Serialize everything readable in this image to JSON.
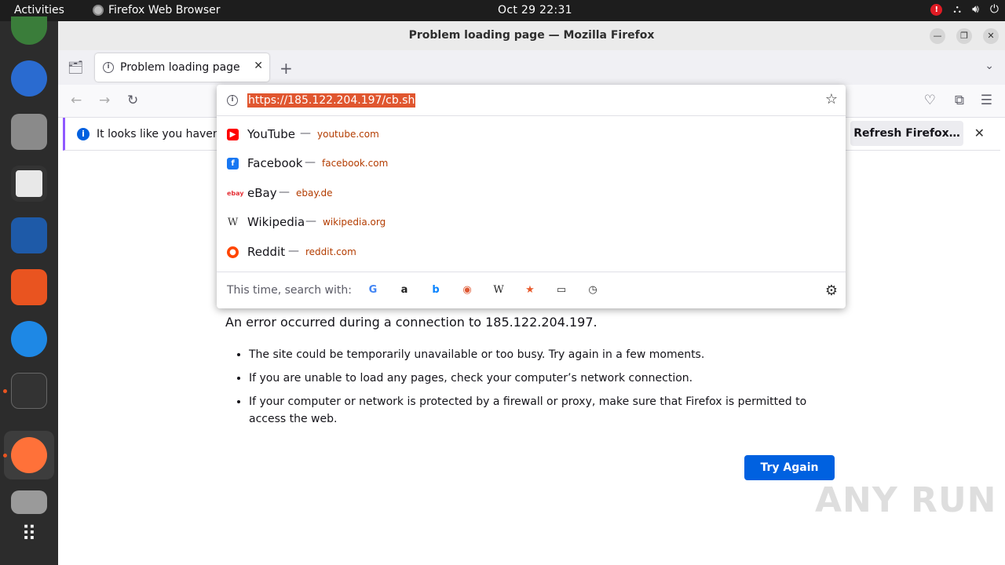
{
  "topbar": {
    "activities": "Activities",
    "app_name": "Firefox Web Browser",
    "clock": "Oct 29  22:31"
  },
  "window": {
    "title": "Problem loading page — Mozilla Firefox"
  },
  "tab": {
    "title": "Problem loading page"
  },
  "notice": {
    "text": "It looks like you haven’t",
    "refresh_label": "Refresh Firefox…"
  },
  "urlbar": {
    "value": "https://185.122.204.197/cb.sh",
    "suggestions": [
      {
        "name": "YouTube",
        "url": "youtube.com",
        "icon": "youtube-icon",
        "color": "#ff0000"
      },
      {
        "name": "Facebook",
        "url": "facebook.com",
        "icon": "facebook-icon",
        "color": "#1877f2"
      },
      {
        "name": "eBay",
        "url": "ebay.de",
        "icon": "ebay-icon",
        "color": "#e53238"
      },
      {
        "name": "Wikipedia",
        "url": "wikipedia.org",
        "icon": "wikipedia-icon",
        "color": "#333333"
      },
      {
        "name": "Reddit",
        "url": "reddit.com",
        "icon": "reddit-icon",
        "color": "#ff4500"
      }
    ],
    "search_with_label": "This time, search with:"
  },
  "error": {
    "description": "An error occurred during a connection to 185.122.204.197.",
    "bullets": [
      "The site could be temporarily unavailable or too busy. Try again in a few moments.",
      "If you are unable to load any pages, check your computer’s network connection.",
      "If your computer or network is protected by a firewall or proxy, make sure that Firefox is permitted to access the web."
    ],
    "try_again_label": "Try Again"
  },
  "watermark": "ANY RUN",
  "colors": {
    "accent": "#0061e0",
    "url_selection": "#e0562f",
    "notice_border": "#9059ff",
    "dock_bg": "#2c2c2c"
  }
}
